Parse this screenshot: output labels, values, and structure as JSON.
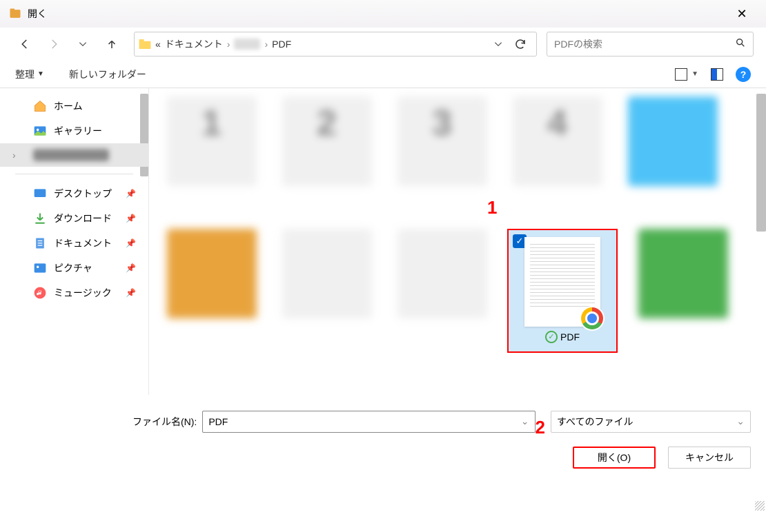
{
  "title": "開く",
  "breadcrumb": {
    "prefix": "«",
    "seg1": "ドキュメント",
    "seg3": "PDF"
  },
  "search_placeholder": "PDFの検索",
  "toolbar": {
    "organize": "整理",
    "newfolder": "新しいフォルダー"
  },
  "sidebar": {
    "home": "ホーム",
    "gallery": "ギャラリー",
    "desktop": "デスクトップ",
    "downloads": "ダウンロード",
    "documents": "ドキュメント",
    "pictures": "ピクチャ",
    "music": "ミュージック"
  },
  "selected_file_label": "PDF",
  "annotations": {
    "a1": "1",
    "a2": "2"
  },
  "filename_label": "ファイル名(N):",
  "filename_value": "PDF",
  "filetype_value": "すべてのファイル",
  "open_btn": "開く(O)",
  "cancel_btn": "キャンセル"
}
